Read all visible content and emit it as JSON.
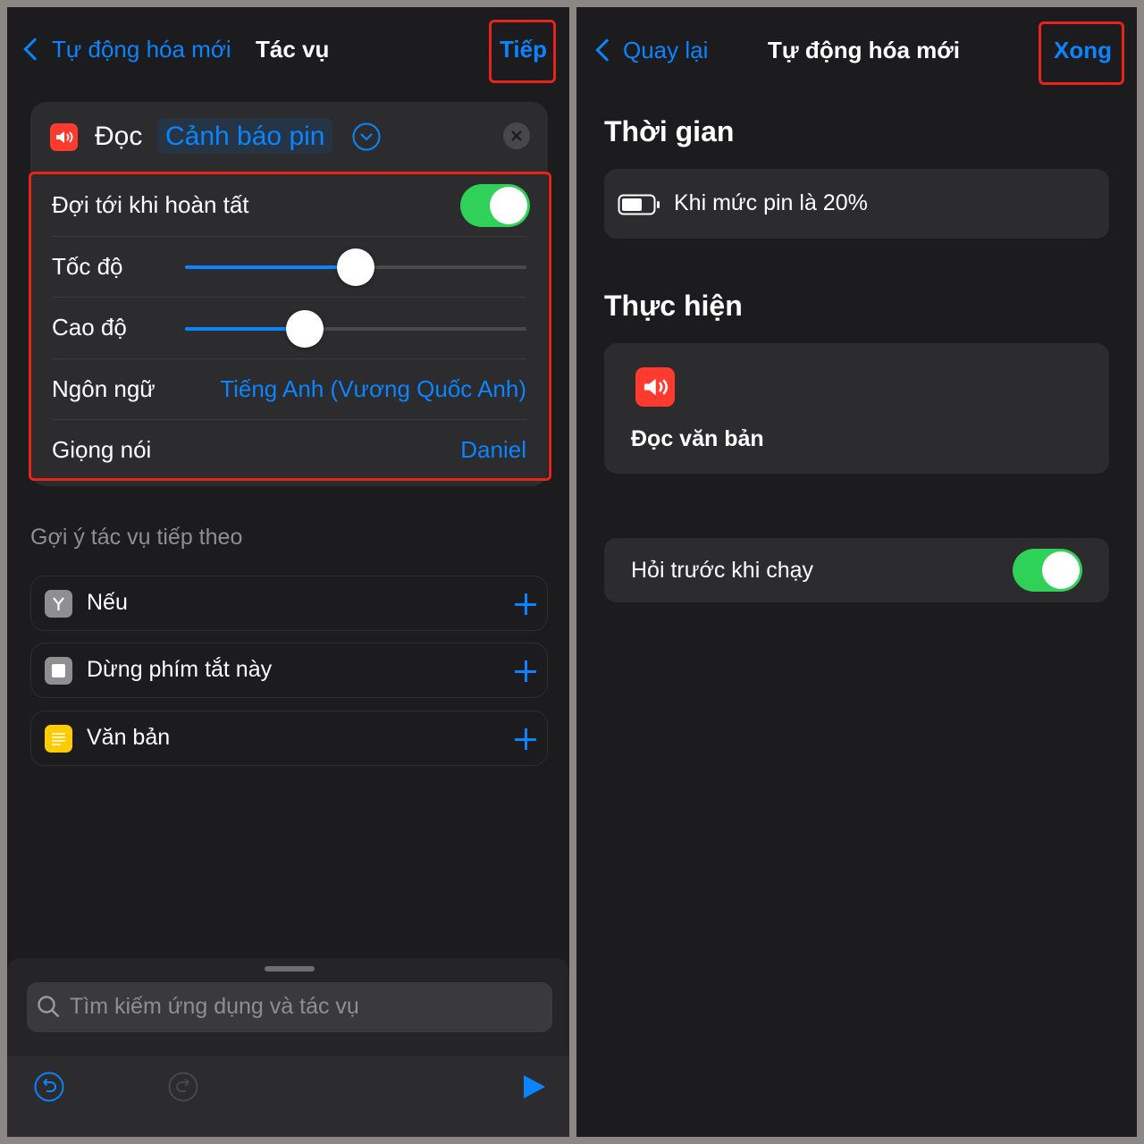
{
  "left": {
    "nav": {
      "back_label": "Tự động hóa mới",
      "title": "Tác vụ",
      "next_label": "Tiếp"
    },
    "action": {
      "verb": "Đọc",
      "param": "Cảnh báo pin",
      "settings": {
        "wait_label": "Đợi tới khi hoàn tất",
        "wait_on": true,
        "rate_label": "Tốc độ",
        "rate_value": 0.5,
        "pitch_label": "Cao độ",
        "pitch_value": 0.35,
        "language_label": "Ngôn ngữ",
        "language_value": "Tiếng Anh (Vương Quốc Anh)",
        "voice_label": "Giọng nói",
        "voice_value": "Daniel"
      }
    },
    "suggestions": {
      "heading": "Gợi ý tác vụ tiếp theo",
      "items": [
        {
          "label": "Nếu",
          "icon": "if-icon",
          "color": "#8e8e93"
        },
        {
          "label": "Dừng phím tắt này",
          "icon": "stop-icon",
          "color": "#8e8e93"
        },
        {
          "label": "Văn bản",
          "icon": "text-icon",
          "color": "#ffcc00"
        }
      ]
    },
    "search": {
      "placeholder": "Tìm kiếm ứng dụng và tác vụ"
    }
  },
  "right": {
    "nav": {
      "back_label": "Quay lại",
      "title": "Tự động hóa mới",
      "done_label": "Xong"
    },
    "when": {
      "heading": "Thời gian",
      "trigger": "Khi mức pin là 20%"
    },
    "do": {
      "heading": "Thực hiện",
      "action_label": "Đọc văn bản"
    },
    "ask": {
      "label": "Hỏi trước khi chạy",
      "on": true
    }
  },
  "colors": {
    "accent": "#0a84ff",
    "toggle_on": "#30d158",
    "highlight": "#e8231b",
    "speak_icon": "#ff3b30"
  }
}
